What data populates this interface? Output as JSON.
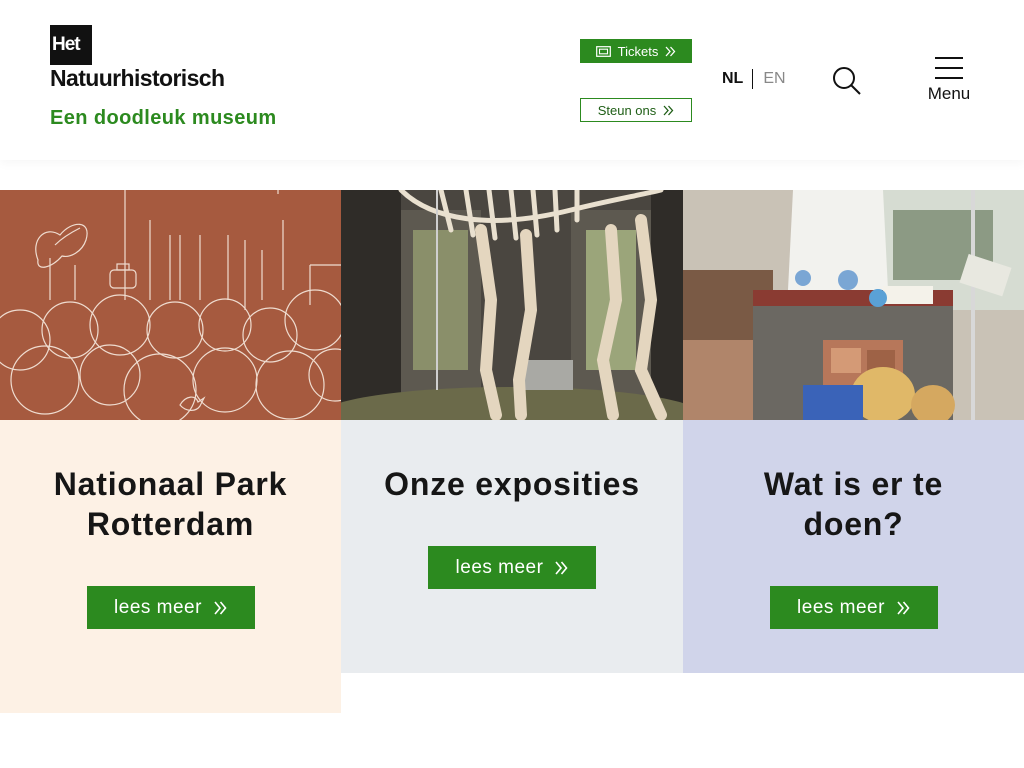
{
  "header": {
    "logo": {
      "het": "Het",
      "name": "Natuurhistorisch"
    },
    "tagline": "Een doodleuk museum",
    "tickets_label": "Tickets",
    "steun_label": "Steun ons",
    "lang": {
      "active": "NL",
      "other": "EN"
    },
    "menu_label": "Menu",
    "icons": {
      "tickets": "ticket-icon",
      "chevron": "double-chevron-right-icon",
      "search": "search-icon",
      "menu": "hamburger-icon"
    }
  },
  "colors": {
    "brand_green": "#2c8a1f",
    "card1_image": "#a65a3f",
    "card1_body": "#fdf1e5",
    "card2_body": "#e9ecef",
    "card3_body": "#d0d4ea"
  },
  "cards": [
    {
      "title": "Nationaal Park Rotterdam",
      "button": "lees meer",
      "image": "illustration-park"
    },
    {
      "title": "Onze exposities",
      "button": "lees meer",
      "image": "photo-skeleton"
    },
    {
      "title": "Wat is er te doen?",
      "button": "lees meer",
      "image": "photo-lab-children"
    }
  ]
}
